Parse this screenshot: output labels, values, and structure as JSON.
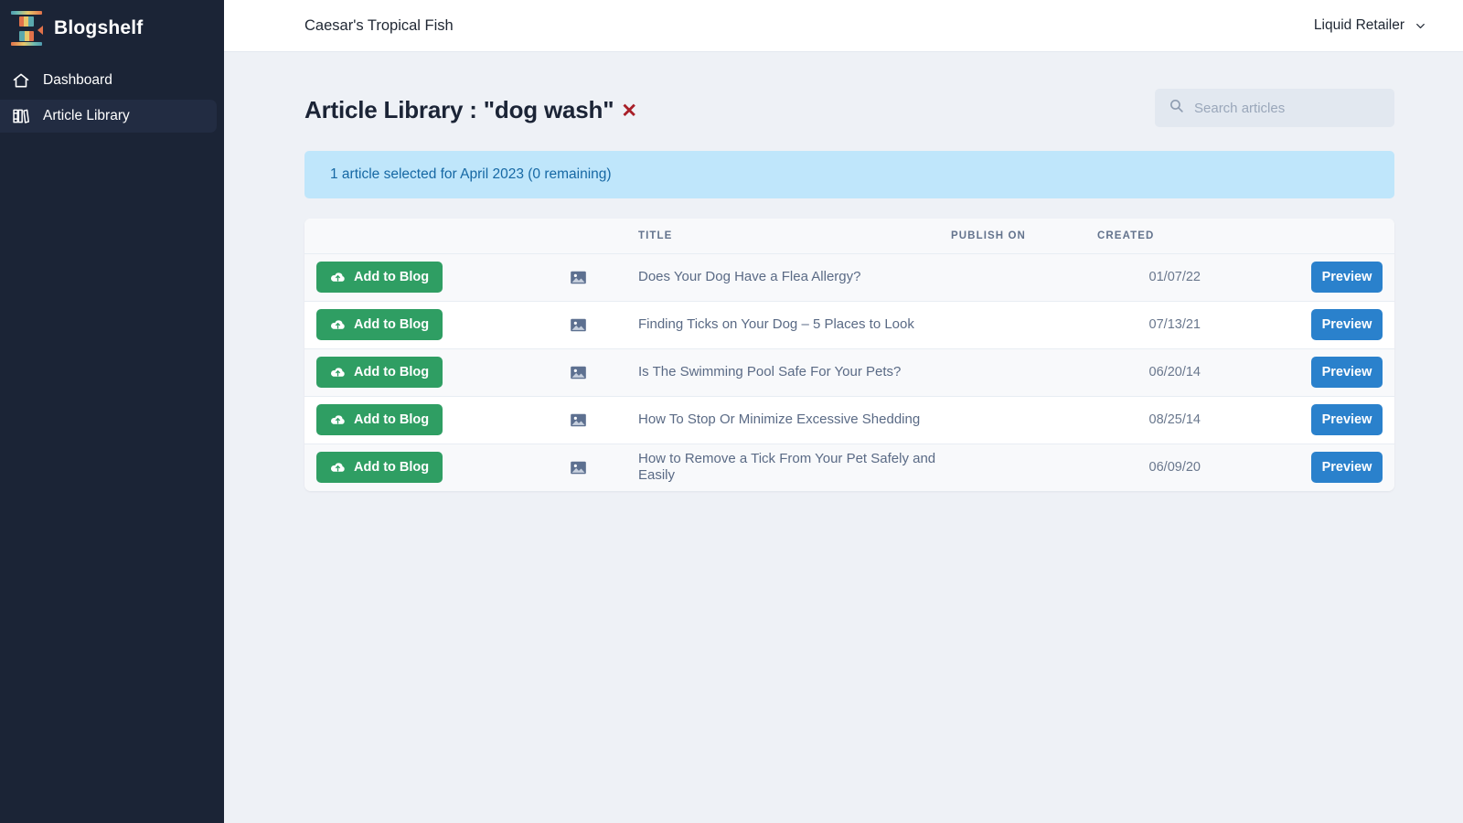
{
  "sidebar": {
    "brand": {
      "name": "Blogshelf",
      "logo_icon": "bookshelf-logo-icon"
    },
    "items": [
      {
        "label": "Dashboard",
        "icon": "home-icon",
        "active": false
      },
      {
        "label": "Article Library",
        "icon": "books-icon",
        "active": true
      }
    ],
    "colors": {
      "background": "#1b2436",
      "active_background": "#222c42",
      "text": "#ffffff"
    }
  },
  "topbar": {
    "title": "Caesar's Tropical Fish",
    "account": {
      "label": "Liquid Retailer",
      "icon": "chevron-down-icon"
    }
  },
  "page": {
    "title": "Article Library : \"dog wash\"",
    "clear_filter": "✕",
    "clear_filter_color": "#a81f28"
  },
  "search": {
    "placeholder": "Search articles",
    "value": "",
    "icon": "search-icon"
  },
  "alert": {
    "message": "1 article selected for April 2023 (0 remaining)",
    "background": "#bfe6fb",
    "text_color": "#1668a4"
  },
  "table": {
    "headers": {
      "action": "",
      "thumb": "",
      "title": "TITLE",
      "publish_on": "PUBLISH ON",
      "created": "CREATED",
      "preview": ""
    },
    "add_label": "Add to Blog",
    "add_icon": "cloud-upload-icon",
    "preview_label": "Preview",
    "thumb_icon": "image-icon",
    "rows": [
      {
        "title": "Does Your Dog Have a Flea Allergy?",
        "publish_on": "",
        "created": "01/07/22"
      },
      {
        "title": "Finding Ticks on Your Dog – 5 Places to Look",
        "publish_on": "",
        "created": "07/13/21"
      },
      {
        "title": "Is The Swimming Pool Safe For Your Pets?",
        "publish_on": "",
        "created": "06/20/14"
      },
      {
        "title": "How To Stop Or Minimize Excessive Shedding",
        "publish_on": "",
        "created": "08/25/14"
      },
      {
        "title": "How to Remove a Tick From Your Pet Safely and Easily",
        "publish_on": "",
        "created": "06/09/20"
      }
    ]
  },
  "colors": {
    "page_background": "#eef1f6",
    "add_button": "#2f9e63",
    "preview_button": "#2a81cc"
  }
}
